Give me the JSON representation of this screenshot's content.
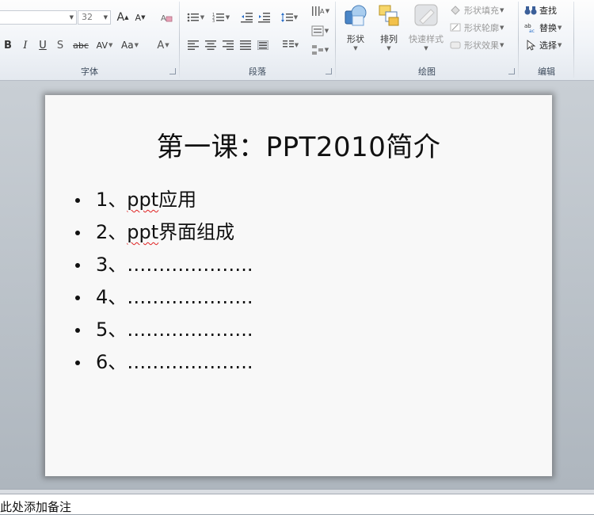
{
  "ribbon": {
    "font_group": {
      "title": "字体",
      "font_size": "32",
      "bold": "B",
      "italic": "I",
      "underline": "U",
      "shadow": "S",
      "strike": "abc",
      "spacing": "AV",
      "case": "Aa",
      "color": "A"
    },
    "paragraph_group": {
      "title": "段落"
    },
    "drawing_group": {
      "title": "绘图",
      "shapes_label": "形状",
      "arrange_label": "排列",
      "quick_styles_label": "快速样式",
      "shape_fill": "形状填充",
      "shape_outline": "形状轮廓",
      "shape_effects": "形状效果"
    },
    "editing_group": {
      "title": "编辑",
      "find": "查找",
      "replace": "替换",
      "select": "选择"
    }
  },
  "slide": {
    "title": "第一课：PPT2010简介",
    "bullets": [
      {
        "num": "1、",
        "word": "ppt",
        "rest": "应用"
      },
      {
        "num": "2、",
        "word": "ppt",
        "rest": "界面组成"
      },
      {
        "num": "3、",
        "word": "",
        "rest": "……………….."
      },
      {
        "num": "4、",
        "word": "",
        "rest": "……………….."
      },
      {
        "num": "5、",
        "word": "",
        "rest": "……………….."
      },
      {
        "num": "6、",
        "word": "",
        "rest": "……………….."
      }
    ]
  },
  "notes": {
    "placeholder": "此处添加备注"
  }
}
